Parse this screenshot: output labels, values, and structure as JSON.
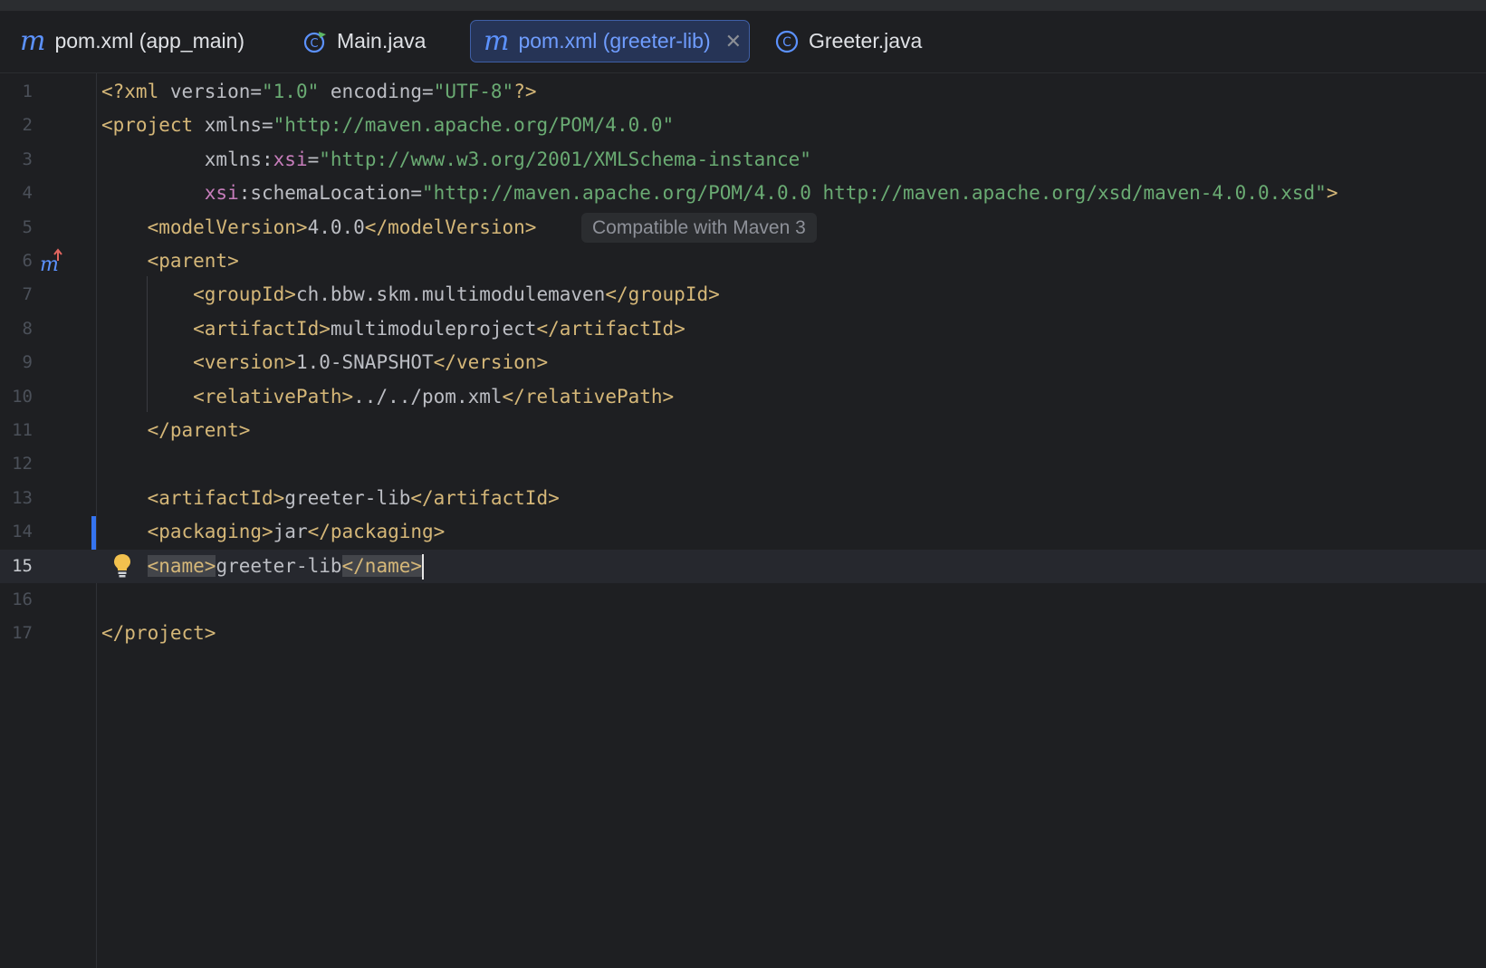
{
  "tabs": [
    {
      "label": "pom.xml (app_main)",
      "icon": "maven-icon",
      "active": false
    },
    {
      "label": "Main.java",
      "icon": "java-main-class-icon",
      "active": false
    },
    {
      "label": "pom.xml (greeter-lib)",
      "icon": "maven-icon",
      "active": true
    },
    {
      "label": "Greeter.java",
      "icon": "java-class-icon",
      "active": false
    }
  ],
  "colors": {
    "background": "#1e1f22",
    "tag": "#d5b778",
    "string": "#6aab73",
    "namespace": "#c77dbb",
    "text": "#bcbec4",
    "accent": "#3574f0"
  },
  "editor": {
    "current_line": 15,
    "inlay_hint": "Compatible with Maven 3",
    "gutter_icons": {
      "6": "maven-parent-navigate-icon",
      "15": "lightbulb-icon"
    },
    "lines": [
      {
        "n": "1",
        "tokens": [
          [
            "tag",
            "<?xml "
          ],
          [
            "attr",
            "version="
          ],
          [
            "str",
            "\"1.0\""
          ],
          [
            "attr",
            " encoding="
          ],
          [
            "str",
            "\"UTF-8\""
          ],
          [
            "tag",
            "?>"
          ]
        ]
      },
      {
        "n": "2",
        "tokens": [
          [
            "tag",
            "<project "
          ],
          [
            "attr",
            "xmlns="
          ],
          [
            "str",
            "\"http://maven.apache.org/POM/4.0.0\""
          ]
        ]
      },
      {
        "n": "3",
        "tokens": [
          [
            "attr",
            "         xmlns:"
          ],
          [
            "ns",
            "xsi"
          ],
          [
            "attr",
            "="
          ],
          [
            "str",
            "\"http://www.w3.org/2001/XMLSchema-instance\""
          ]
        ]
      },
      {
        "n": "4",
        "tokens": [
          [
            "ns",
            "         xsi"
          ],
          [
            "attr",
            ":schemaLocation="
          ],
          [
            "str",
            "\"http://maven.apache.org/POM/4.0.0 http://maven.apache.org/xsd/maven-4.0.0.xsd\""
          ],
          [
            "tag",
            ">"
          ]
        ]
      },
      {
        "n": "5",
        "tokens": [
          [
            "tag",
            "    <modelVersion>"
          ],
          [
            "txt",
            "4.0.0"
          ],
          [
            "tag",
            "</modelVersion>"
          ]
        ]
      },
      {
        "n": "6",
        "tokens": [
          [
            "tag",
            "    <parent>"
          ]
        ]
      },
      {
        "n": "7",
        "tokens": [
          [
            "tag",
            "        <groupId>"
          ],
          [
            "txt",
            "ch.bbw.skm.multimodulemaven"
          ],
          [
            "tag",
            "</groupId>"
          ]
        ]
      },
      {
        "n": "8",
        "tokens": [
          [
            "tag",
            "        <artifactId>"
          ],
          [
            "txt",
            "multimoduleproject"
          ],
          [
            "tag",
            "</artifactId>"
          ]
        ]
      },
      {
        "n": "9",
        "tokens": [
          [
            "tag",
            "        <version>"
          ],
          [
            "txt",
            "1.0-SNAPSHOT"
          ],
          [
            "tag",
            "</version>"
          ]
        ]
      },
      {
        "n": "10",
        "tokens": [
          [
            "tag",
            "        <relativePath>"
          ],
          [
            "txt",
            "../../pom.xml"
          ],
          [
            "tag",
            "</relativePath>"
          ]
        ]
      },
      {
        "n": "11",
        "tokens": [
          [
            "tag",
            "    </parent>"
          ]
        ]
      },
      {
        "n": "12",
        "tokens": []
      },
      {
        "n": "13",
        "tokens": [
          [
            "tag",
            "    <artifactId>"
          ],
          [
            "txt",
            "greeter-lib"
          ],
          [
            "tag",
            "</artifactId>"
          ]
        ]
      },
      {
        "n": "14",
        "tokens": [
          [
            "tag",
            "    <packaging>"
          ],
          [
            "txt",
            "jar"
          ],
          [
            "tag",
            "</packaging>"
          ]
        ]
      },
      {
        "n": "15",
        "tokens": [
          [
            "txt",
            "    "
          ],
          [
            "tag hl",
            "<name>"
          ],
          [
            "txt",
            "greeter-lib"
          ],
          [
            "tag hl",
            "</name>"
          ]
        ]
      },
      {
        "n": "16",
        "tokens": []
      },
      {
        "n": "17",
        "tokens": [
          [
            "tag",
            "</project>"
          ]
        ]
      }
    ]
  }
}
